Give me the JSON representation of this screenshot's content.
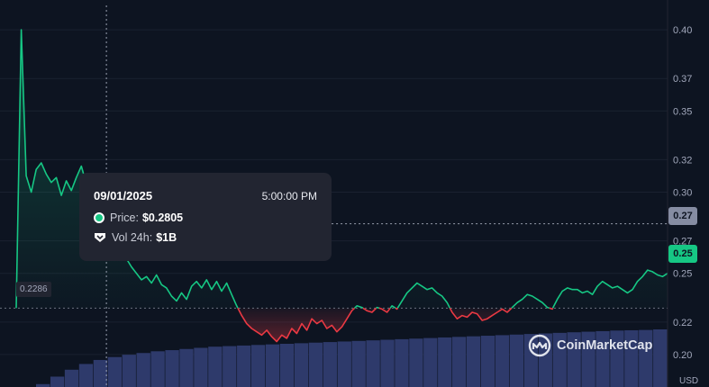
{
  "chart_data": {
    "type": "line",
    "y_axis": {
      "ticks": [
        "0.40",
        "0.37",
        "0.35",
        "0.32",
        "0.30",
        "0.27",
        "0.25",
        "0.22",
        "0.20"
      ],
      "range": [
        0.18,
        0.415
      ],
      "position": "right"
    },
    "grid": true,
    "baseline": 0.2286,
    "series": [
      {
        "values": [
          0.2286,
          0.4,
          0.31,
          0.3,
          0.314,
          0.318,
          0.311,
          0.306,
          0.309,
          0.298,
          0.307,
          0.301,
          0.309,
          0.316,
          0.305,
          0.3,
          0.289,
          0.285,
          0.2805,
          0.272,
          0.264,
          0.262,
          0.259,
          0.254,
          0.25,
          0.246,
          0.248,
          0.244,
          0.249,
          0.243,
          0.241,
          0.236,
          0.233,
          0.238,
          0.234,
          0.242,
          0.245,
          0.241,
          0.246,
          0.24,
          0.245,
          0.239,
          0.244,
          0.237,
          0.23,
          0.224,
          0.219,
          0.216,
          0.214,
          0.212,
          0.215,
          0.211,
          0.208,
          0.212,
          0.21,
          0.216,
          0.213,
          0.219,
          0.215,
          0.222,
          0.219,
          0.221,
          0.216,
          0.218,
          0.214,
          0.217,
          0.222,
          0.227,
          0.23,
          0.229,
          0.227,
          0.226,
          0.229,
          0.228,
          0.226,
          0.23,
          0.228,
          0.233,
          0.238,
          0.241,
          0.244,
          0.242,
          0.24,
          0.241,
          0.238,
          0.236,
          0.232,
          0.226,
          0.222,
          0.224,
          0.223,
          0.226,
          0.225,
          0.221,
          0.222,
          0.224,
          0.226,
          0.228,
          0.226,
          0.229,
          0.232,
          0.234,
          0.237,
          0.236,
          0.234,
          0.232,
          0.229,
          0.228,
          0.234,
          0.239,
          0.241,
          0.24,
          0.24,
          0.238,
          0.239,
          0.237,
          0.242,
          0.245,
          0.243,
          0.241,
          0.242,
          0.24,
          0.238,
          0.24,
          0.245,
          0.248,
          0.252,
          0.251,
          0.249,
          0.248,
          0.25
        ],
        "color": "#16c784"
      }
    ],
    "negative_color": "#ea3943",
    "volume_24h": {
      "values": [
        0.05,
        0.18,
        0.3,
        0.4,
        0.47,
        0.52,
        0.56,
        0.59,
        0.62,
        0.64,
        0.66,
        0.68,
        0.7,
        0.71,
        0.72,
        0.73,
        0.74,
        0.75,
        0.76,
        0.77,
        0.78,
        0.79,
        0.8,
        0.81,
        0.82,
        0.83,
        0.84,
        0.85,
        0.86,
        0.87,
        0.88,
        0.89,
        0.9,
        0.91,
        0.92,
        0.93,
        0.94,
        0.95,
        0.96,
        0.97,
        0.98,
        0.985,
        0.99,
        1
      ],
      "color": "#2e3a6b"
    },
    "hover": {
      "date": "09/01/2025",
      "time": "5:00:00 PM",
      "price_label": "Price:",
      "price": "$0.2805",
      "price_value": 0.2805,
      "volume_label": "Vol 24h:",
      "volume": "$1B",
      "axis_badge": "0.27"
    },
    "current_price_badge": "0.25",
    "baseline_label": "0.2286",
    "unit": "USD",
    "watermark": "CoinMarketCap"
  }
}
